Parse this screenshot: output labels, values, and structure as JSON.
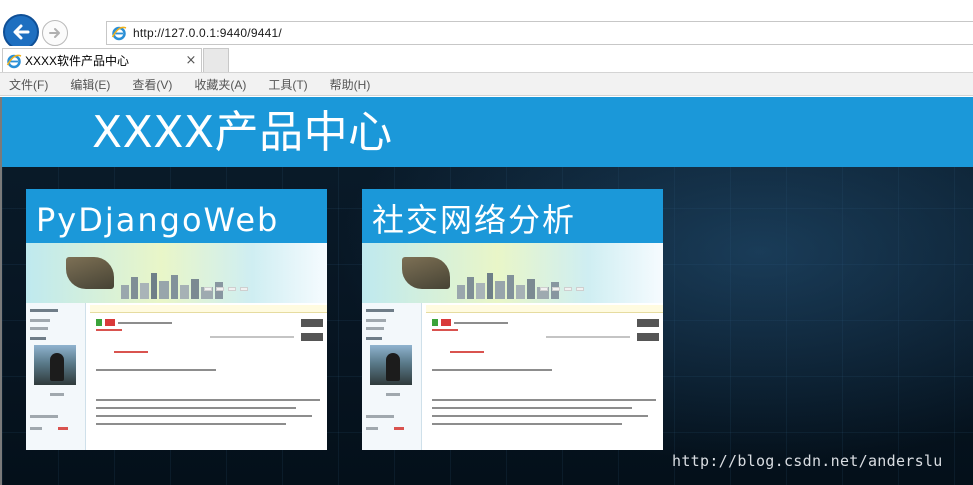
{
  "browser": {
    "address": "http://127.0.0.1:9440/9441/",
    "tab_title": "XXXX软件产品中心",
    "tab_close": "×",
    "menu": [
      "文件(F)",
      "编辑(E)",
      "查看(V)",
      "收藏夹(A)",
      "工具(T)",
      "帮助(H)"
    ],
    "icons": {
      "back": "back-arrow-icon",
      "forward": "forward-arrow-icon",
      "page": "internet-explorer-icon"
    }
  },
  "page": {
    "header_title": "XXXX产品中心",
    "header_color": "#1b98d9",
    "cards": [
      {
        "title": "PyDjangoWeb"
      },
      {
        "title": "社交网络分析"
      }
    ],
    "watermark": "http://blog.csdn.net/anderslu"
  }
}
